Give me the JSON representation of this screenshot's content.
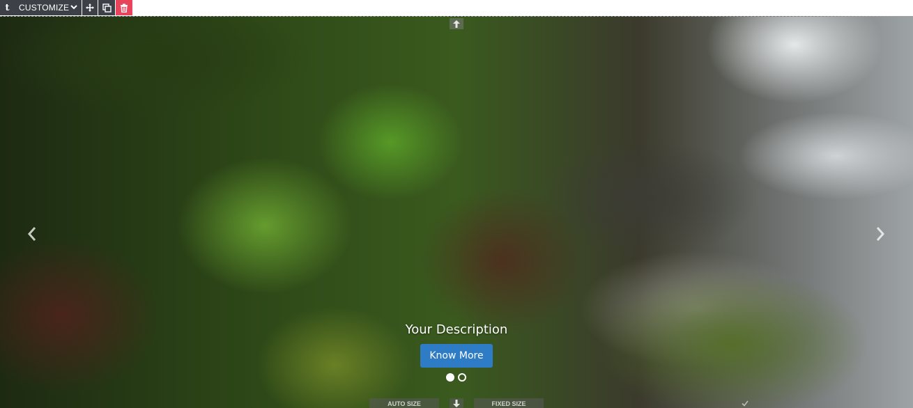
{
  "toolbar": {
    "logo_letter": "t",
    "customize_label": "CUSTOMIZE",
    "icons": [
      "move-icon",
      "duplicate-icon",
      "trash-icon"
    ],
    "delete_color": "#e8445c",
    "bar_color": "#3d4046"
  },
  "slider": {
    "description": "Your Description",
    "button_label": "Know More",
    "button_color": "#2e7cc6",
    "active_slide": 1,
    "slide_count": 2
  },
  "bottom_controls": {
    "auto_size_label": "AUTO SIZE",
    "fixed_size_label": "FIXED SIZE"
  }
}
